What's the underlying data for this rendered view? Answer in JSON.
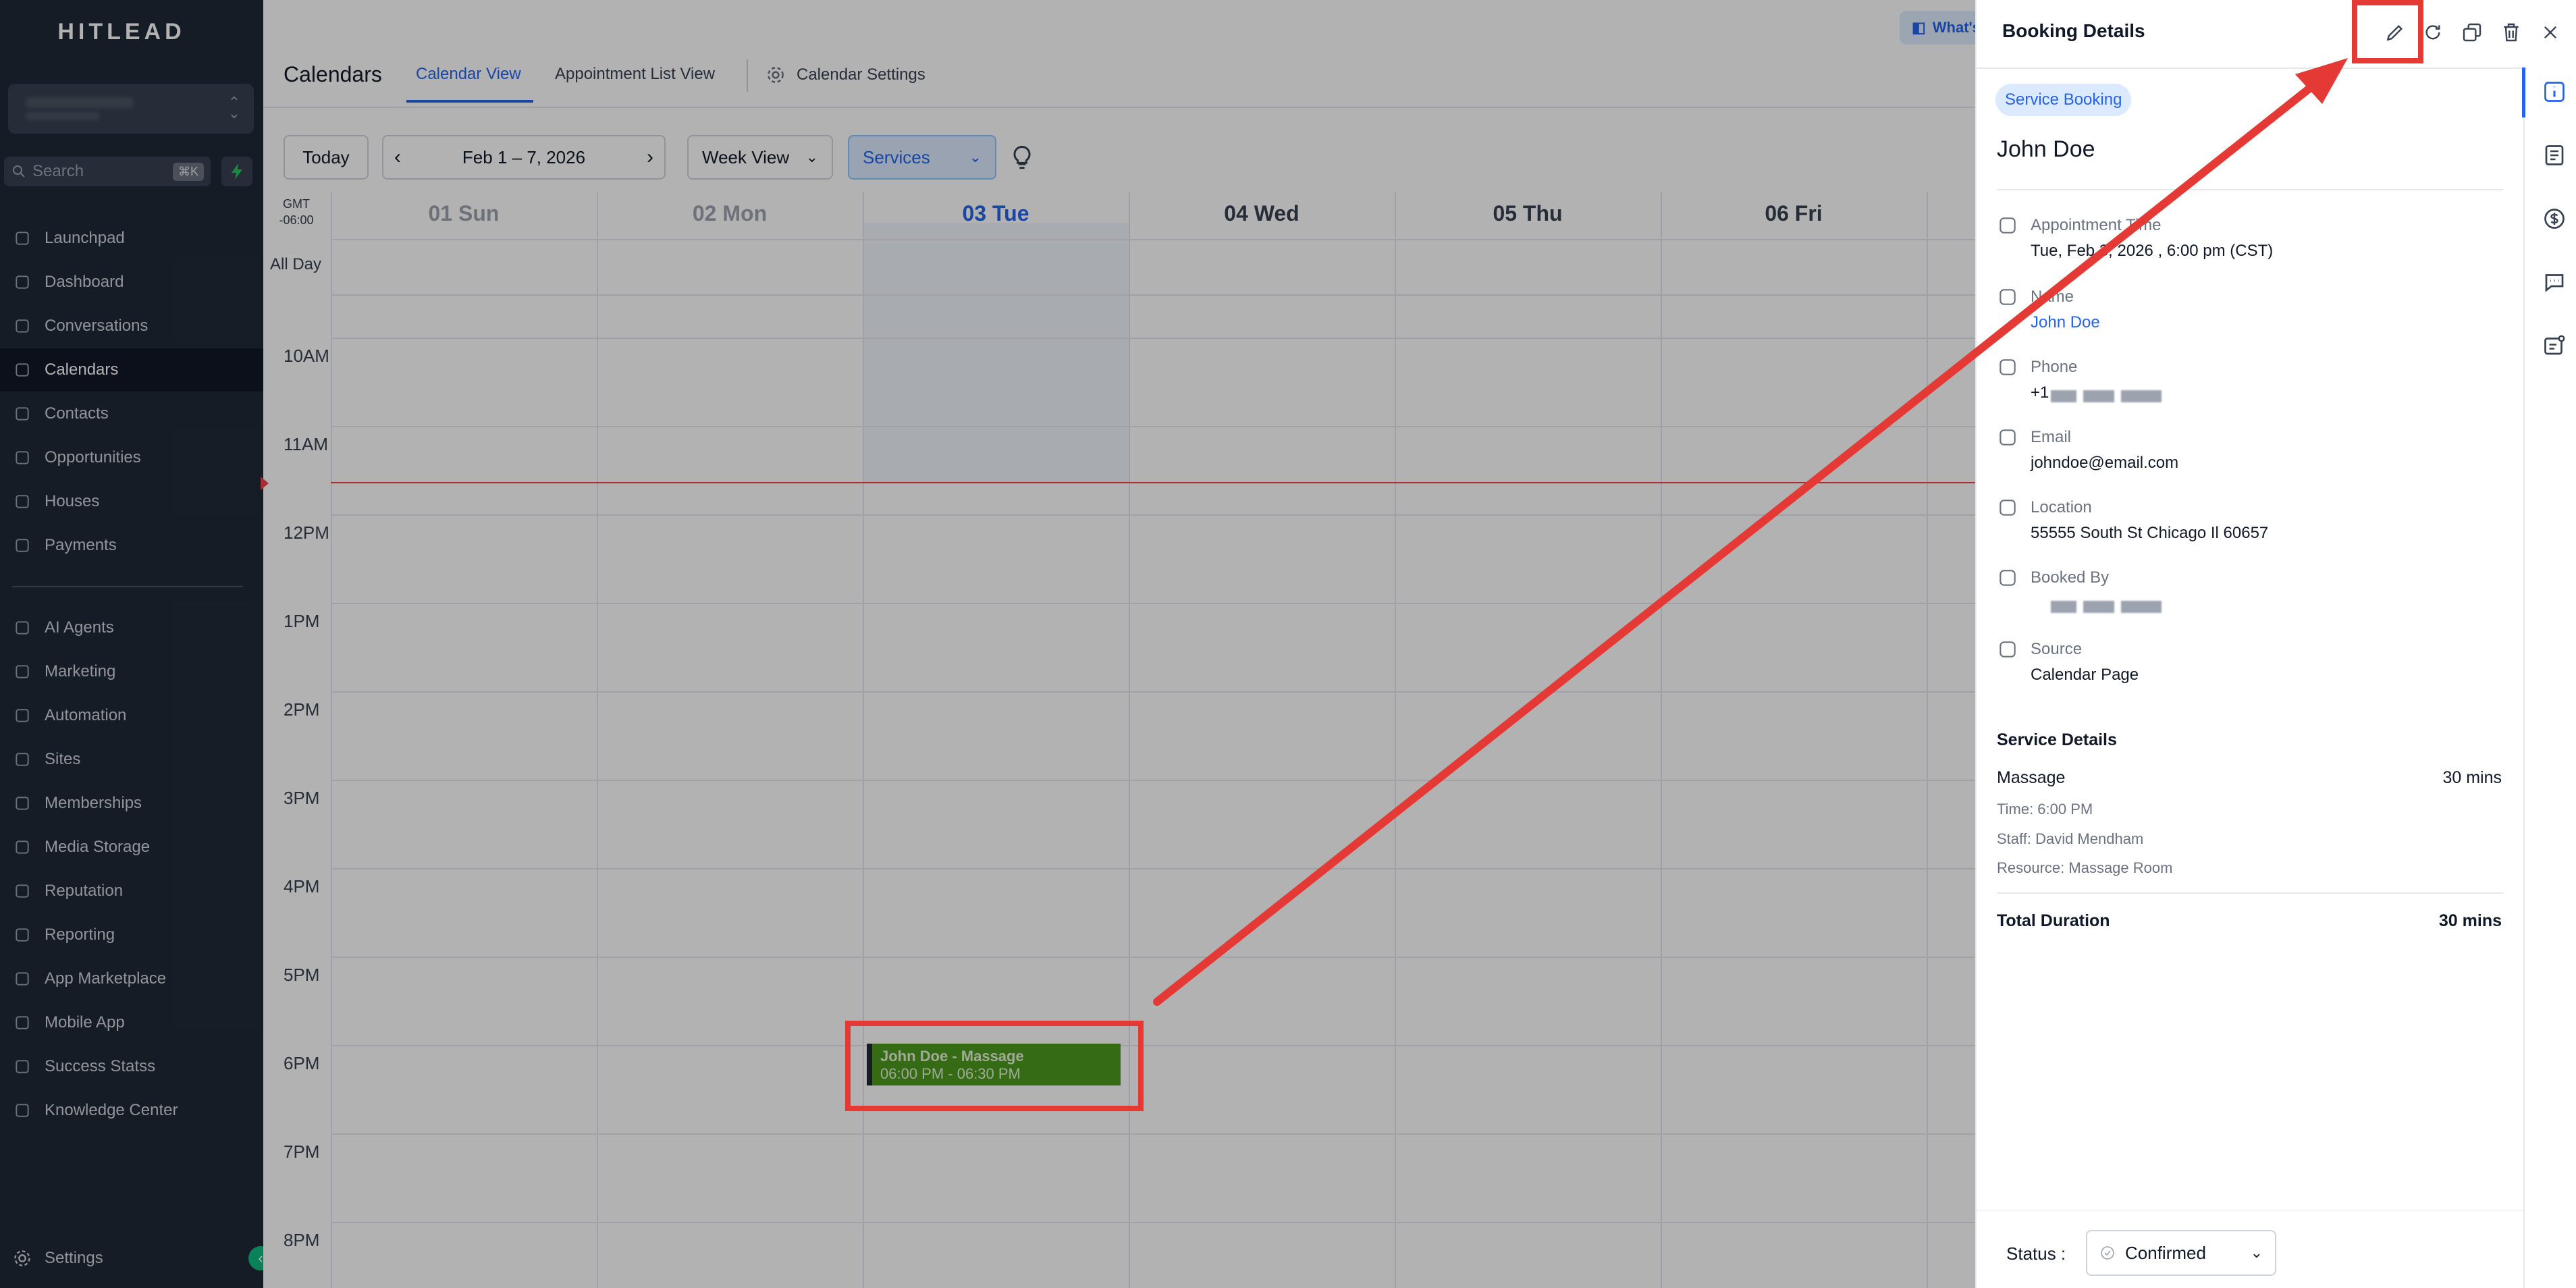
{
  "brand": "HITLEAD",
  "search": {
    "placeholder": "Search",
    "shortcut": "⌘K"
  },
  "nav": {
    "items": [
      {
        "label": "Launchpad",
        "icon": "rocket-icon"
      },
      {
        "label": "Dashboard",
        "icon": "grid-icon"
      },
      {
        "label": "Conversations",
        "icon": "chat-icon"
      },
      {
        "label": "Calendars",
        "icon": "calendar-icon"
      },
      {
        "label": "Contacts",
        "icon": "contacts-icon"
      },
      {
        "label": "Opportunities",
        "icon": "opportunities-icon"
      },
      {
        "label": "Houses",
        "icon": "house-icon"
      },
      {
        "label": "Payments",
        "icon": "payments-icon"
      },
      {
        "label": "AI Agents",
        "icon": "sparkle-icon"
      },
      {
        "label": "Marketing",
        "icon": "send-icon"
      },
      {
        "label": "Automation",
        "icon": "automation-icon"
      },
      {
        "label": "Sites",
        "icon": "sites-icon"
      },
      {
        "label": "Memberships",
        "icon": "membership-icon"
      },
      {
        "label": "Media Storage",
        "icon": "image-icon"
      },
      {
        "label": "Reputation",
        "icon": "star-icon"
      },
      {
        "label": "Reporting",
        "icon": "trend-icon"
      },
      {
        "label": "App Marketplace",
        "icon": "apps-icon"
      },
      {
        "label": "Mobile App",
        "icon": "phone-icon"
      },
      {
        "label": "Success Statss",
        "icon": "stats-icon"
      },
      {
        "label": "Knowledge Center",
        "icon": "info-icon"
      }
    ],
    "active_index": 3,
    "settings_label": "Settings"
  },
  "header": {
    "title": "Calendars",
    "tabs": [
      "Calendar View",
      "Appointment List View"
    ],
    "settings_label": "Calendar Settings",
    "whats_new": "What's"
  },
  "toolbar": {
    "today": "Today",
    "range": "Feb 1 – 7, 2026",
    "view": "Week View",
    "filter": "Services"
  },
  "calendar": {
    "timezone": "GMT\n-06:00",
    "all_day": "All Day",
    "days": [
      "01 Sun",
      "02 Mon",
      "03 Tue",
      "04 Wed",
      "05 Thu",
      "06 Fri"
    ],
    "hours": [
      "10AM",
      "11AM",
      "12PM",
      "1PM",
      "2PM",
      "3PM",
      "4PM",
      "5PM",
      "6PM",
      "7PM",
      "8PM"
    ],
    "event": {
      "title": "John Doe - Massage",
      "time": "06:00 PM - 06:30 PM"
    }
  },
  "booking": {
    "panel_title": "Booking Details",
    "badge": "Service Booking",
    "customer": "John Doe",
    "fields": [
      {
        "label": "Appointment Time",
        "value": "Tue, Feb 3, 2026 , 6:00 pm (CST)",
        "icon": "calendar-icon"
      },
      {
        "label": "Name",
        "value": "John Doe",
        "icon": "user-circle-icon"
      },
      {
        "label": "Phone",
        "value": "+1",
        "icon": "phone-call-icon"
      },
      {
        "label": "Email",
        "value": "johndoe@email.com",
        "icon": "mail-icon"
      },
      {
        "label": "Location",
        "value": "55555 South St Chicago Il 60657",
        "icon": "location-pin-icon"
      },
      {
        "label": "Booked By",
        "value": "",
        "icon": "user-icon"
      },
      {
        "label": "Source",
        "value": "Calendar Page",
        "icon": "device-icon"
      }
    ],
    "service_section": "Service Details",
    "service": {
      "name": "Massage",
      "duration": "30 mins",
      "time": "Time: 6:00 PM",
      "staff": "Staff: David Mendham",
      "resource": "Resource: Massage Room"
    },
    "total_label": "Total Duration",
    "total_value": "30 mins",
    "status_label": "Status :",
    "status_value": "Confirmed"
  },
  "colors": {
    "accent": "#2563eb",
    "event": "#4d9a1f",
    "annotation": "#e53935",
    "sidebar": "#1f2937"
  }
}
